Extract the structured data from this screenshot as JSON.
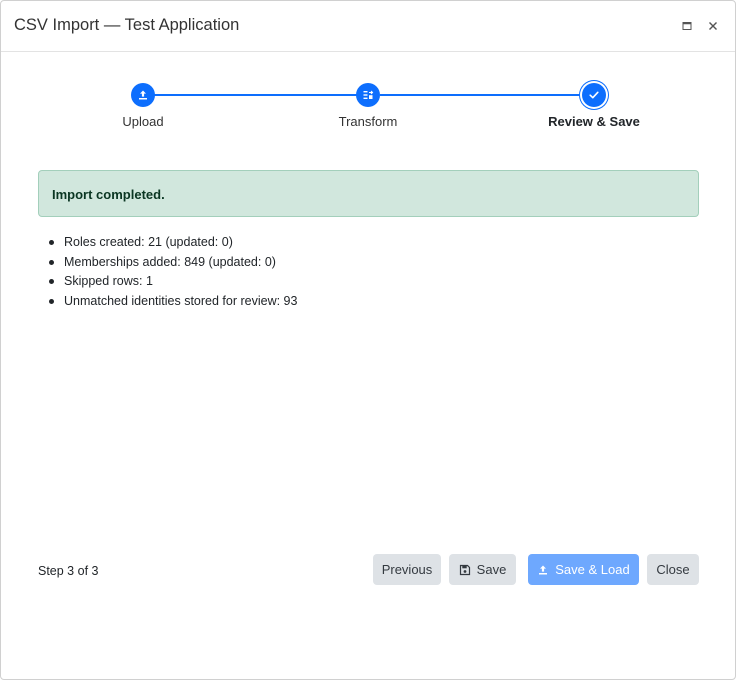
{
  "window": {
    "title": "CSV Import — Test Application",
    "controls": [
      "maximize-icon",
      "close-icon"
    ]
  },
  "stepper": {
    "accent_color": "#0d6efd",
    "current_step": 3,
    "steps": [
      {
        "label": "Upload",
        "icon": "upload-icon",
        "state": "complete"
      },
      {
        "label": "Transform",
        "icon": "transform-icon",
        "state": "complete"
      },
      {
        "label": "Review & Save",
        "icon": "check-icon",
        "state": "active"
      }
    ]
  },
  "alert": {
    "text": "Import completed.",
    "status": "success",
    "background_color": "#d1e7dd"
  },
  "results": [
    "Roles created: 21 (updated: 0)",
    "Memberships added: 849 (updated: 0)",
    "Skipped rows: 1",
    "Unmatched identities stored for review: 93"
  ],
  "footer": {
    "step_text": "Step 3 of 3",
    "buttons": {
      "previous": "Previous",
      "save": "Save",
      "save_load": "Save & Load",
      "close": "Close"
    }
  }
}
